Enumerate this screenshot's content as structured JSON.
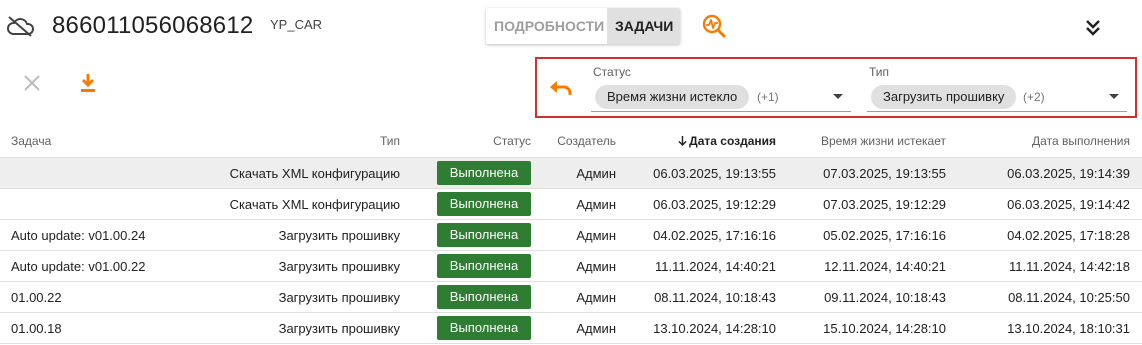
{
  "header": {
    "device_id": "866011056068612",
    "device_name": "YP_CAR",
    "tabs": [
      {
        "label": "ПОДРОБНОСТИ",
        "active": false
      },
      {
        "label": "ЗАДАЧИ",
        "active": true
      }
    ]
  },
  "filters": {
    "status": {
      "label": "Статус",
      "chip": "Время жизни истекло",
      "extra": "(+1)"
    },
    "type": {
      "label": "Тип",
      "chip": "Загрузить прошивку",
      "extra": "(+2)"
    }
  },
  "table": {
    "columns": {
      "task": "Задача",
      "type": "Тип",
      "status": "Статус",
      "creator": "Создатель",
      "created": "Дата создания",
      "expires": "Время жизни истекает",
      "completed": "Дата выполнения"
    },
    "sort_icon": "arrow-down-icon",
    "rows": [
      {
        "task": "",
        "type": "Скачать XML конфигурацию",
        "status": "Выполнена",
        "creator": "Админ",
        "created": "06.03.2025, 19:13:55",
        "expires": "07.03.2025, 19:13:55",
        "completed": "06.03.2025, 19:14:39"
      },
      {
        "task": "",
        "type": "Скачать XML конфигурацию",
        "status": "Выполнена",
        "creator": "Админ",
        "created": "06.03.2025, 19:12:29",
        "expires": "07.03.2025, 19:12:29",
        "completed": "06.03.2025, 19:14:42"
      },
      {
        "task": "Auto update: v01.00.24",
        "type": "Загрузить прошивку",
        "status": "Выполнена",
        "creator": "Админ",
        "created": "04.02.2025, 17:16:16",
        "expires": "05.02.2025, 17:16:16",
        "completed": "04.02.2025, 17:18:28"
      },
      {
        "task": "Auto update: v01.00.22",
        "type": "Загрузить прошивку",
        "status": "Выполнена",
        "creator": "Админ",
        "created": "11.11.2024, 14:40:21",
        "expires": "12.11.2024, 14:40:21",
        "completed": "11.11.2024, 14:42:18"
      },
      {
        "task": "01.00.22",
        "type": "Загрузить прошивку",
        "status": "Выполнена",
        "creator": "Админ",
        "created": "08.11.2024, 10:18:43",
        "expires": "09.11.2024, 10:18:43",
        "completed": "08.11.2024, 10:25:50"
      },
      {
        "task": "01.00.18",
        "type": "Загрузить прошивку",
        "status": "Выполнена",
        "creator": "Админ",
        "created": "13.10.2024, 14:28:10",
        "expires": "15.10.2024, 14:28:10",
        "completed": "13.10.2024, 18:10:31"
      }
    ]
  },
  "colors": {
    "accent": "#f57c00",
    "status_done": "#2e7d32",
    "highlight_border": "#d32f2f"
  }
}
